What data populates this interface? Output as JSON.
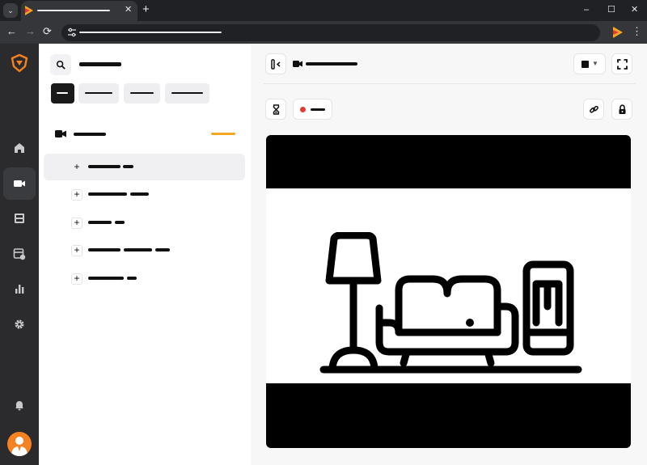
{
  "browser": {
    "tab": {
      "favicon": "play-triangle-icon",
      "close_glyph": "✕"
    },
    "new_tab_glyph": "+",
    "window_controls": {
      "minimize": "–",
      "maximize": "☐",
      "close": "✕"
    },
    "nav": {
      "back": "←",
      "forward": "→",
      "reload": "⟳"
    },
    "menu_glyph": "⋮"
  },
  "rail": {
    "logo": "shield-logo-icon",
    "items": [
      {
        "icon": "home-icon"
      },
      {
        "icon": "video-camera-icon",
        "active": true
      },
      {
        "icon": "film-icon"
      },
      {
        "icon": "schedule-icon"
      },
      {
        "icon": "bar-chart-icon"
      },
      {
        "icon": "gear-icon"
      },
      {
        "icon": "bell-icon"
      }
    ],
    "avatar": "user-avatar"
  },
  "panel": {
    "search_icon": "search-icon",
    "filters": [
      {
        "active": true
      },
      {
        "active": false
      },
      {
        "active": false
      },
      {
        "active": false
      }
    ],
    "section": {
      "icon": "video-camera-icon"
    },
    "rows": [
      {
        "expand_glyph": "+",
        "selected": true
      },
      {
        "expand_glyph": "+",
        "selected": false
      },
      {
        "expand_glyph": "+",
        "selected": false
      },
      {
        "expand_glyph": "+",
        "selected": false
      },
      {
        "expand_glyph": "+",
        "selected": false
      }
    ]
  },
  "content": {
    "header_icons": [
      "sidebar-collapse-icon",
      "video-camera-icon",
      "layout-dropdown-icon",
      "fullscreen-icon"
    ],
    "toolbar_icons": [
      "hourglass-icon",
      "live-indicator",
      "link-icon",
      "lock-icon"
    ],
    "colors": {
      "accent": "#F5A623",
      "live": "#E53935",
      "rail_bg": "#2B2B2E"
    },
    "video": {
      "placeholder_icon": "living-room-furniture-icon"
    }
  }
}
